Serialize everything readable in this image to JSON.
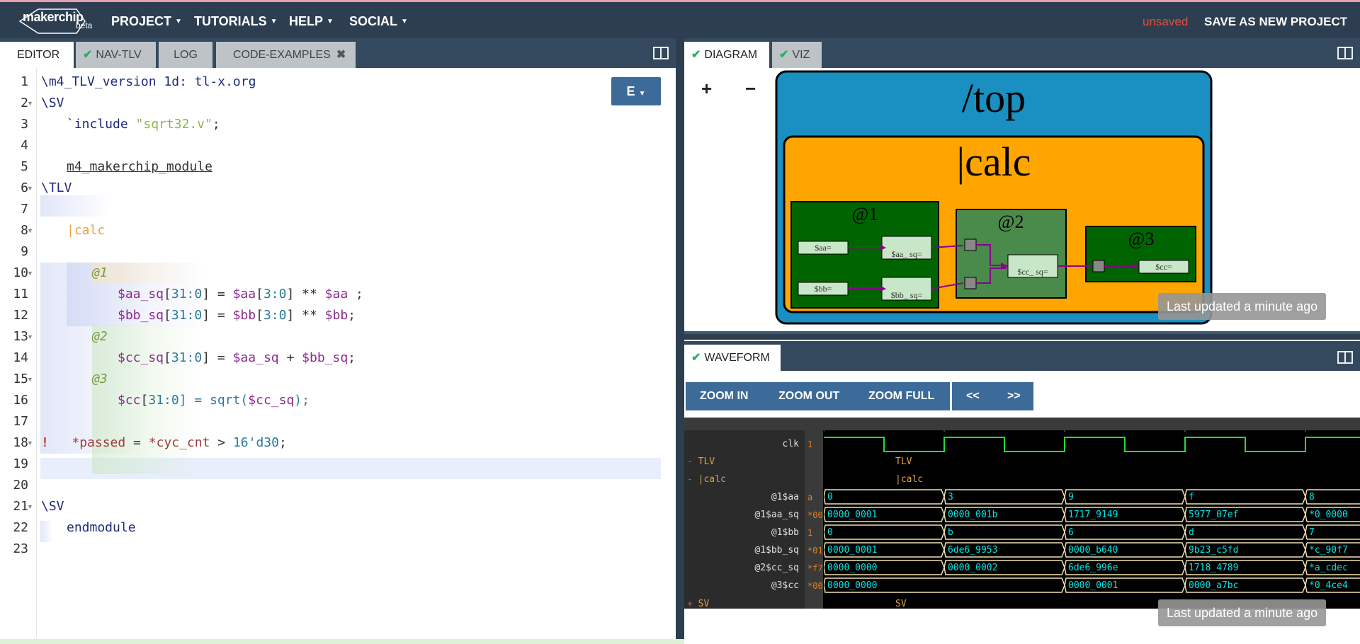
{
  "app": {
    "logo_text": "makerchip",
    "logo_badge": "beta",
    "menus": [
      {
        "label": "PROJECT"
      },
      {
        "label": "TUTORIALS"
      },
      {
        "label": "HELP"
      },
      {
        "label": "SOCIAL"
      }
    ],
    "save_status": "unsaved",
    "save_new_label": "SAVE AS NEW PROJECT"
  },
  "left_tabs": [
    {
      "label": "EDITOR",
      "active": true
    },
    {
      "label": "NAV-TLV",
      "checked": true
    },
    {
      "label": "LOG"
    },
    {
      "label": "CODE-EXAMPLES",
      "closable": true
    }
  ],
  "editor": {
    "dropdown_label": "E",
    "line_numbers": [
      "1",
      "2",
      "3",
      "4",
      "5",
      "6",
      "7",
      "8",
      "9",
      "10",
      "11",
      "12",
      "13",
      "14",
      "15",
      "16",
      "17",
      "18",
      "19",
      "20",
      "21",
      "22",
      "23"
    ],
    "tokens": {
      "l1": "\\m4_TLV_version 1d: tl-x.org",
      "l2": "\\SV",
      "l3a": "`include ",
      "l3b": "\"sqrt32.v\"",
      "l3c": ";",
      "l5": "m4_makerchip_module",
      "l6": "\\TLV",
      "l8": "|calc",
      "l10": "@1",
      "l11a": "$aa_sq",
      "l11b": "[",
      "l11c": "31:0",
      "l11d": "] = ",
      "l11e": "$aa",
      "l11f": "[",
      "l11g": "3:0",
      "l11h": "] ** ",
      "l11i": "$aa",
      "l11j": " ;",
      "l12a": "$bb_sq",
      "l12b": "[",
      "l12c": "31:0",
      "l12d": "] = ",
      "l12e": "$bb",
      "l12f": "[",
      "l12g": "3:0",
      "l12h": "] ** ",
      "l12i": "$bb",
      "l12j": ";",
      "l13": "@2",
      "l14a": "$cc_sq",
      "l14b": "[",
      "l14c": "31:0",
      "l14d": "] = ",
      "l14e": "$aa_sq",
      "l14f": " + ",
      "l14g": "$bb_sq",
      "l14h": ";",
      "l15": "@3",
      "l16a": "$cc",
      "l16b": "[",
      "l16c": "31:0",
      "l16d": "] = sqrt(",
      "l16e": "$cc_sq",
      "l16f": ");",
      "l18mark": "!",
      "l18a": "*passed",
      "l18b": " = ",
      "l18c": "*cyc_cnt",
      "l18d": " > ",
      "l18e": "16'd30",
      "l18f": ";",
      "l21": "\\SV",
      "l22": "endmodule"
    }
  },
  "right_top_tabs": [
    {
      "label": "DIAGRAM",
      "active": true,
      "checked": true
    },
    {
      "label": "VIZ",
      "checked": true
    }
  ],
  "diagram": {
    "zoom_in": "+",
    "zoom_out": "−",
    "expand": "⤢",
    "top_label": "/top",
    "pipe_label": "|calc",
    "stages": [
      {
        "label": "@1",
        "signals": [
          "$aa=",
          "$aa_ sq=",
          "$bb=",
          "$bb_ sq="
        ]
      },
      {
        "label": "@2",
        "signals": [
          "$cc_ sq="
        ]
      },
      {
        "label": "@3",
        "signals": [
          "$cc="
        ]
      }
    ],
    "colors": {
      "top_bg": "#1a8fc1",
      "pipe_bg": "#ffa500",
      "stage1_bg": "#006400",
      "stage2_bg": "#4a8a4a",
      "wire": "#8b008b"
    },
    "updated": "Last updated a minute ago"
  },
  "waveform": {
    "tab_label": "WAVEFORM",
    "buttons": [
      "ZOOM IN",
      "ZOOM OUT",
      "ZOOM FULL"
    ],
    "nav_buttons": [
      "<<",
      ">>"
    ],
    "signals": [
      {
        "name": "clk",
        "value": "1"
      },
      {
        "name": "TLV",
        "scope": true,
        "marker": "-",
        "label": "TLV"
      },
      {
        "name": "|calc",
        "scope": true,
        "marker": "-",
        "label": "|calc"
      },
      {
        "name": "@1$aa",
        "value": "a",
        "cells": [
          "0",
          "3",
          "9",
          "f",
          "8"
        ]
      },
      {
        "name": "@1$aa_sq",
        "value": "*00",
        "cells": [
          "0000_0001",
          "0000_001b",
          "1717_9149",
          "5977_07ef",
          "*0_0000"
        ]
      },
      {
        "name": "@1$bb",
        "value": "1",
        "cells": [
          "0",
          "b",
          "6",
          "d",
          "7"
        ]
      },
      {
        "name": "@1$bb_sq",
        "value": "*01",
        "cells": [
          "0000_0001",
          "6de6_9953",
          "0000_b640",
          "9b23_c5fd",
          "*c_90f7"
        ]
      },
      {
        "name": "@2$cc_sq",
        "value": "*f7",
        "cells": [
          "0000_0000",
          "0000_0002",
          "6de6_996e",
          "1718_4789",
          "*a_cdec"
        ]
      },
      {
        "name": "@3$cc",
        "value": "*00",
        "cells": [
          "0000_0000",
          "0000_0001",
          "0000_a7bc",
          "*0_4ce4"
        ]
      },
      {
        "name": "SV",
        "scope": true,
        "marker": "+",
        "label": "SV"
      }
    ],
    "updated": "Last updated a minute ago"
  }
}
